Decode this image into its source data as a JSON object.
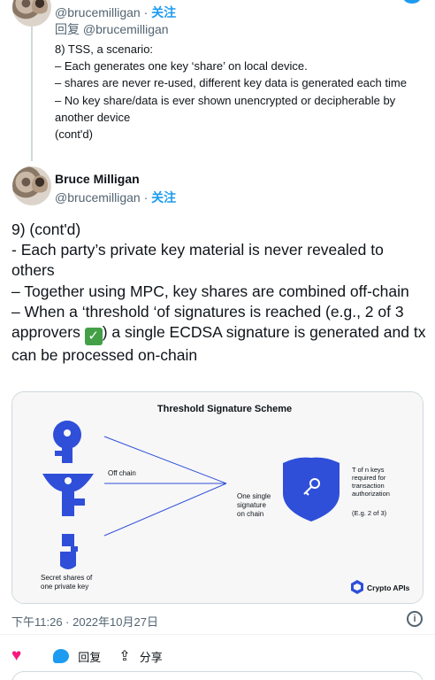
{
  "reply_tweet": {
    "handle": "@brucemilligan",
    "sep": " · ",
    "follow": "关注",
    "reply_prefix": "回复 ",
    "reply_mention": "@brucemilligan",
    "lines": [
      "8) TSS, a scenario:",
      "– Each generates one key ‘share’ on local device.",
      "– shares are never re-used, different key data is generated each time",
      "– No key share/data is ever shown unencrypted or decipherable by another device",
      "(cont'd)"
    ]
  },
  "main_tweet": {
    "name": "Bruce Milligan",
    "handle": "@brucemilligan",
    "sep": " · ",
    "follow": "关注",
    "lines": [
      "9) (cont'd)",
      "- Each party’s private key material is never revealed to others",
      "– Together using MPC, key shares are combined off-chain"
    ],
    "last_line_before": "– When a ‘threshold ‘of signatures is reached (e.g., 2 of 3 approvers ",
    "check_glyph": "✓",
    "last_line_after": ") a single ECDSA signature is generated and tx can be processed on-chain",
    "timestamp": "下午11:26 · 2022年10月27日",
    "info_glyph": "i"
  },
  "card": {
    "title": "Threshold Signature Scheme",
    "off_chain": "Off chain",
    "one_single_1": "One single",
    "one_single_2": "signature",
    "one_single_3": "on chain",
    "secret_1": "Secret shares of",
    "secret_2": "one private key",
    "t_of_n_1": "T of n keys",
    "t_of_n_2": "required for",
    "t_of_n_3": "transaction",
    "t_of_n_4": "authorization",
    "eg": "(E.g. 2 of 3)",
    "brand": "Crypto APIs",
    "accent": "#2f4fd9"
  },
  "actions": {
    "reply_label": "回复",
    "share_label": "分享"
  }
}
